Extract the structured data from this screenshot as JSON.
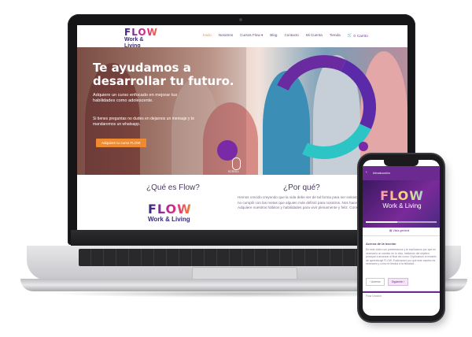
{
  "site": {
    "logo_word": "FLOW",
    "logo_sub": "Work & Living",
    "nav": [
      "Inicio",
      "Nosotros",
      "Cursos Flow",
      "Blog",
      "Contacto",
      "Mi Cuenta",
      "Tienda",
      "Carrito"
    ],
    "cart_count": "0"
  },
  "hero": {
    "title": "Te ayudamos a desarrollar tu futuro.",
    "subtitle": "Adquiere un curso enfocado en mejorar tus habilidades como adolescente.",
    "subtitle2": "Si tienes preguntas no dudes en dejarnos un mensaje y te mandaremos un whatsapp.",
    "button": "Adquiere tu curso FLOW",
    "scroll": "SCROLL"
  },
  "about": {
    "q1": "¿Qué es Flow?",
    "q2": "¿Por qué?",
    "paragraph": "Hemos crecido creyendo que la vida debe ser de tal forma para ser exitosos y felices, y nos frustramos al no cumplir con las metas que alguien más definió para nosotros. Nos hace vivir enojados y con miedo. Adquiere nuestros hábitos y habilidades para vivir plenamente y feliz. Construye mejor..."
  },
  "phone": {
    "header": "Introducción",
    "tab": "Vista general",
    "section_title": "Acerca de la lección",
    "body": "En este video nos presentamos y te explicamos por qué es necesario un cambio en tu vida, hablando del objetivo principal a alcanzar al final del curso: Explicamos el modelo de aprendizaje FLOW. Explicamos por qué este cambio es necesario y cómo te llevará a la felicidad...",
    "prev": "Anterior",
    "next": "Siguiente",
    "footer": "Flow Lección"
  },
  "colors": {
    "accent_orange": "#f08a2e",
    "brand_purple": "#6a2a90",
    "brand_teal": "#2cc4c4"
  }
}
